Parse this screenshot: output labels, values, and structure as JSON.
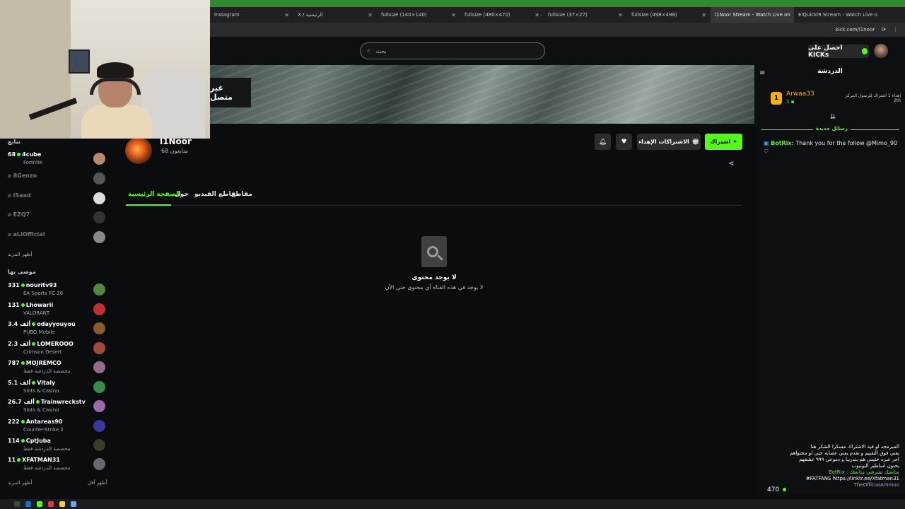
{
  "browser": {
    "tabs": [
      {
        "title": "Instagram",
        "icon": "instagram-icon"
      },
      {
        "title": "X / الرئيسية",
        "icon": "x-icon"
      },
      {
        "title": "fullsize (140×140)",
        "icon": "image-icon"
      },
      {
        "title": "fullsize (480×470)",
        "icon": "image-icon"
      },
      {
        "title": "fullsize (37×27)",
        "icon": "image-icon"
      },
      {
        "title": "fullsize (498×498)",
        "icon": "image-icon"
      },
      {
        "title": "l1Noor Stream - Watch Live on",
        "icon": "kick-icon"
      },
      {
        "title": "ElQuickl9 Stream - Watch Live o",
        "icon": "kick-icon"
      }
    ],
    "url": "kick.com/l1noor"
  },
  "header": {
    "search_placeholder": "بحث",
    "kicks_label": "احصل على KICKs"
  },
  "banner": {
    "offline_label": "غير متصل"
  },
  "profile": {
    "name": "l1Noor",
    "followers": "68 متابعون",
    "subscribe_label": "اشتراك",
    "gift_label": "الاشتراكات الإهداء"
  },
  "channel_tabs": {
    "home": "الصفحة الرئيسية",
    "about": "حول",
    "videos": "مقاطع الفيديو",
    "clips": "مقاطع"
  },
  "empty": {
    "title": "لا يوجد محتوى",
    "subtitle": "لا يوجد في هذه القناة أي محتوى حتى الآن"
  },
  "sidebar": {
    "following_title": "تتابع",
    "following": [
      {
        "count": "68",
        "name": "4cube",
        "category": "Fortnite",
        "live": true
      },
      {
        "name": "8Genzo",
        "live": false
      },
      {
        "name": "iSaad",
        "live": false
      },
      {
        "name": "EZQ7",
        "live": false
      },
      {
        "name": "aLIOfficial",
        "live": false
      }
    ],
    "show_more": "أظهر المزيد",
    "recommended_title": "موصى بها",
    "recommended": [
      {
        "count": "331",
        "name": "nouritv93",
        "category": "EA Sports FC 26"
      },
      {
        "count": "131",
        "name": "Lhowarii",
        "category": "VALORANT"
      },
      {
        "count": "3.4 ألف",
        "name": "odayyouyou",
        "category": "PUBG Mobile"
      },
      {
        "count": "2.3 ألف",
        "name": "LOMEROOO",
        "category": "Crimson Desert"
      },
      {
        "count": "787",
        "name": "MOJREMCO",
        "category": "مخصصة للدردشة فقط"
      },
      {
        "count": "5.1 ألف",
        "name": "Vitaly",
        "category": "Slots & Casino"
      },
      {
        "count": "26.7 ألف",
        "name": "Trainwreckstv",
        "category": "Slots & Casino"
      },
      {
        "count": "222",
        "name": "Antareas90",
        "category": "Counter-Strike 2"
      },
      {
        "count": "114",
        "name": "CptJuba",
        "category": "مخصصة للدردشة فقط"
      },
      {
        "count": "11",
        "name": "XFATMAN31",
        "category": "مخصصة للدردشة فقط"
      }
    ],
    "show_more_2": "أظهر المزيد",
    "show_less": "أظهر أقل"
  },
  "chat": {
    "title": "الدردشة",
    "pinned_user": "Arwaa33",
    "pinned_meta": "1",
    "pinned_time": "2th",
    "pinned_text": "إهداء 1 اشتراك للرسول المركز",
    "new_messages": "رسائل جديدة",
    "message_user": "BotRix:",
    "message_text": "Thank you for the follow @Mimo_90 ♡"
  },
  "overlay": {
    "lines": [
      "المبرمجه لو فية الاشتراك مسكرا الشكر هنا",
      "يعني فوق التقييم و تقدم يعني عصابة حتى لو محتواهم",
      "اخر عبره ختيس هم بتدريبا و دموعي ٩٩٩ عشقهم",
      "يحبون اساطير اليوتيوب",
      "BotRix : متابعتك تشرفني متابعتك",
      "#FATFANS https://linktr.ee/Xfatman31",
      "TheOfficialAmmoo"
    ],
    "viewers": "470"
  },
  "colors": {
    "accent": "#53fc18",
    "badge": "#f5b301"
  }
}
